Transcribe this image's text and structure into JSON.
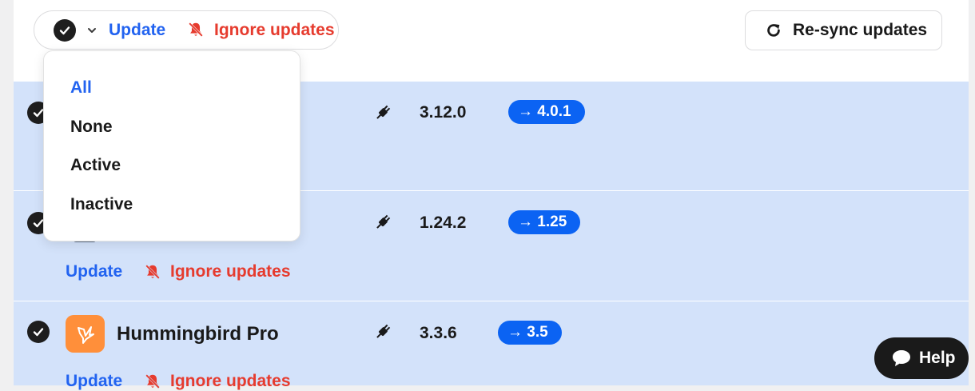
{
  "toolbar": {
    "update_label": "Update",
    "ignore_label": "Ignore updates",
    "resync_label": "Re-sync updates"
  },
  "dropdown": {
    "items": [
      "All",
      "None",
      "Active",
      "Inactive"
    ],
    "active_index": 0
  },
  "rows": [
    {
      "version": "3.12.0",
      "new_version": "→ 4.0.1",
      "checked": true
    },
    {
      "version": "1.24.2",
      "new_version": "→ 1.25",
      "update_label": "Update",
      "ignore_label": "Ignore updates",
      "checked": true
    },
    {
      "name": "Hummingbird Pro",
      "version": "3.3.6",
      "new_version": "→ 3.5",
      "update_label": "Update",
      "ignore_label": "Ignore updates",
      "checked": true
    }
  ],
  "help": {
    "label": "Help"
  },
  "colors": {
    "row_bg": "#d3e2fa",
    "link_blue": "#2263f0",
    "ignore_red": "#e63b2e",
    "badge_blue": "#0b63f3",
    "plugin_orange": "#ff8f3a"
  },
  "icons": [
    "check-icon",
    "chevron-down-icon",
    "bell-off-icon",
    "refresh-icon",
    "plug-icon",
    "hummingbird-icon",
    "chat-icon"
  ]
}
